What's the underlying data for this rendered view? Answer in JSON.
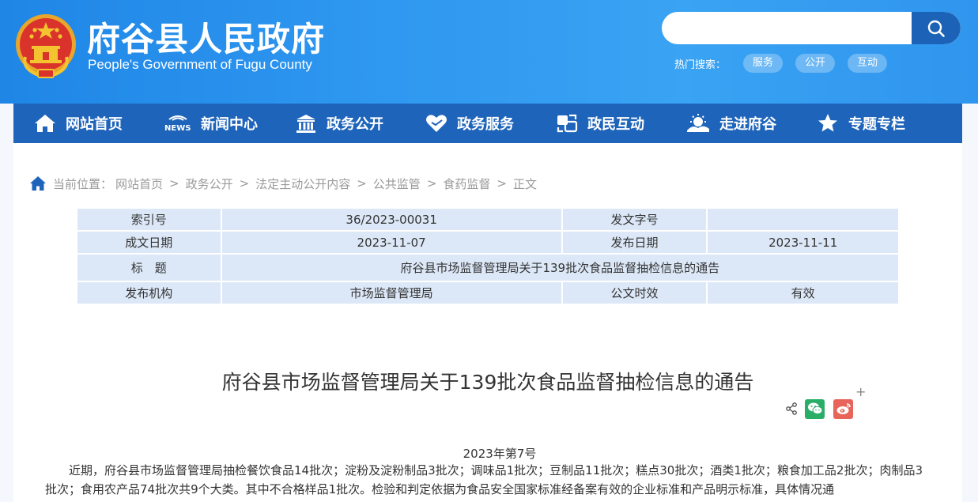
{
  "header": {
    "title": "府谷县人民政府",
    "subtitle": "People's Government of Fugu County",
    "search": {
      "value": "",
      "placeholder": ""
    },
    "hot_search": {
      "label": "热门搜索：",
      "tags": [
        "服务",
        "公开",
        "互动"
      ]
    }
  },
  "nav": {
    "items": [
      {
        "label": "网站首页",
        "icon": "home-icon"
      },
      {
        "label": "新闻中心",
        "icon": "news-icon"
      },
      {
        "label": "政务公开",
        "icon": "government-building-icon"
      },
      {
        "label": "政务服务",
        "icon": "heart-service-icon"
      },
      {
        "label": "政民互动",
        "icon": "interaction-icon"
      },
      {
        "label": "走进府谷",
        "icon": "landscape-icon"
      },
      {
        "label": "专题专栏",
        "icon": "star-badge-icon"
      }
    ]
  },
  "breadcrumb": {
    "label": "当前位置：",
    "items": [
      "网站首页",
      "政务公开",
      "法定主动公开内容",
      "公共监管",
      "食药监督",
      "正文"
    ],
    "separator": ">"
  },
  "meta": {
    "index_label": "索引号",
    "index_value": "36/2023-00031",
    "doc_no_label": "发文字号",
    "doc_no_value": "",
    "created_label": "成文日期",
    "created_value": "2023-11-07",
    "published_label": "发布日期",
    "published_value": "2023-11-11",
    "title_label": "标　题",
    "title_value": "府谷县市场监督管理局关于139批次食品监督抽检信息的通告",
    "org_label": "发布机构",
    "org_value": "市场监督管理局",
    "validity_label": "公文时效",
    "validity_value": "有效"
  },
  "article": {
    "title": "府谷县市场监督管理局关于139批次食品监督抽检信息的通告",
    "doc_number": "2023年第7号",
    "body": "近期，府谷县市场监督管理局抽检餐饮食品14批次；淀粉及淀粉制品3批次；调味品1批次；豆制品11批次；糕点30批次；酒类1批次；粮食加工品2批次；肉制品3批次；食用农产品74批次共9个大类。其中不合格样品1批次。检验和判定依据为食品安全国家标准经备案有效的企业标准和产品明示标准，具体情况通"
  },
  "share": {
    "plus": "+",
    "icons": [
      "share-icon",
      "wechat-icon",
      "weibo-icon"
    ]
  },
  "colors": {
    "header_bg": "#2f98f0",
    "nav_bg": "#1e64ba",
    "search_btn": "#1c63b8",
    "table_bg": "#dce8f7",
    "wechat": "#2aae67",
    "weibo": "#e8645a"
  }
}
